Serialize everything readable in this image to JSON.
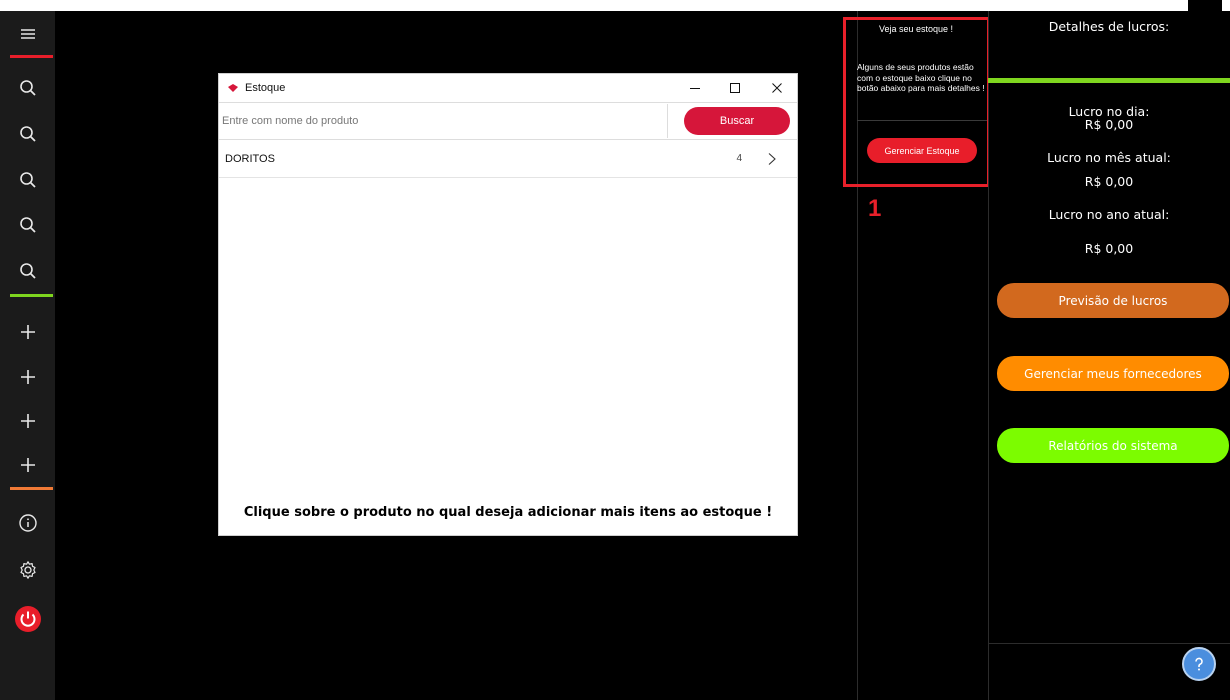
{
  "rail": {
    "accent_colors": {
      "top": "#e81e2a",
      "middle": "#7fd61f",
      "bottom": "#f07a36"
    },
    "search_buttons": [
      "search-icon",
      "search-icon",
      "search-icon",
      "search-icon",
      "search-icon"
    ],
    "add_buttons": [
      "plus-icon",
      "plus-icon",
      "plus-icon",
      "plus-icon"
    ],
    "icons": {
      "menu": "hamburger-icon",
      "info": "info-icon",
      "settings": "gear-icon",
      "power": "power-icon"
    }
  },
  "estoque_window": {
    "title": "Estoque",
    "search": {
      "placeholder": "Entre com nome do produto",
      "value": ""
    },
    "buscar_label": "Buscar",
    "products": [
      {
        "name": "DORITOS",
        "qty": "4"
      }
    ],
    "footer_text": "Clique sobre o produto no qual deseja adicionar mais itens ao estoque !",
    "accent": "#d6163a"
  },
  "stock_alert": {
    "title": "Veja seu estoque !",
    "message": "Alguns de seus produtos estão com o estoque baixo clique no botão abaixo para mais detalhes !",
    "button_label": "Gerenciar Estoque",
    "annotation": "1",
    "highlight_color": "#e8202a"
  },
  "profit": {
    "heading": "Detalhes de lucros:",
    "bar_color": "#7fd61f",
    "rows": [
      {
        "label": "Lucro no dia:",
        "value": "R$ 0,00"
      },
      {
        "label": "Lucro no mês atual:",
        "value": "R$ 0,00"
      },
      {
        "label": "Lucro no ano atual:",
        "value": "R$ 0,00"
      }
    ],
    "buttons": [
      {
        "label": "Previsão de lucros",
        "color": "#d2691e"
      },
      {
        "label": "Gerenciar meus fornecedores",
        "color": "#ff8c00"
      },
      {
        "label": "Relatórios do sistema",
        "color": "#7cfc00"
      }
    ],
    "help_icon": "help-icon"
  }
}
